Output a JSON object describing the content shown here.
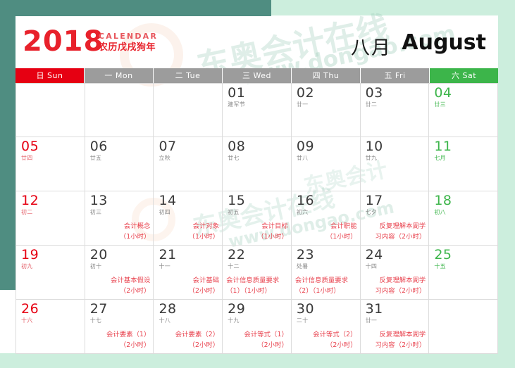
{
  "header": {
    "year": "2018",
    "subtitle_en": "CALENDAR",
    "subtitle_cn": "农历戊戌狗年",
    "month_cn": "八月",
    "month_en": "August"
  },
  "watermark": {
    "brand_cn": "东奥会计在线",
    "brand_cn_short": "东奥会计",
    "url": "www.dongao.com"
  },
  "colors": {
    "sunday": "#e60012",
    "saturday": "#3cb54a",
    "weekday_header": "#9c9c9c",
    "event_text": "#e8404c",
    "year_red": "#e8212b",
    "frame_teal": "#4f8d81",
    "frame_mint": "#cceedd"
  },
  "weekdays": [
    {
      "label": "日 Sun",
      "kind": "sun"
    },
    {
      "label": "一 Mon",
      "kind": "weekday"
    },
    {
      "label": "二 Tue",
      "kind": "weekday"
    },
    {
      "label": "三 Wed",
      "kind": "weekday"
    },
    {
      "label": "四 Thu",
      "kind": "weekday"
    },
    {
      "label": "五 Fri",
      "kind": "weekday"
    },
    {
      "label": "六 Sat",
      "kind": "sat"
    }
  ],
  "weeks": [
    [
      {
        "empty": true
      },
      {
        "empty": true
      },
      {
        "empty": true
      },
      {
        "day": "01",
        "lunar": "建军节",
        "event": ""
      },
      {
        "day": "02",
        "lunar": "廿一",
        "event": ""
      },
      {
        "day": "03",
        "lunar": "廿二",
        "event": ""
      },
      {
        "day": "04",
        "lunar": "廿三",
        "event": ""
      }
    ],
    [
      {
        "day": "05",
        "lunar": "廿四",
        "event": ""
      },
      {
        "day": "06",
        "lunar": "廿五",
        "event": ""
      },
      {
        "day": "07",
        "lunar": "立秋",
        "event": ""
      },
      {
        "day": "08",
        "lunar": "廿七",
        "event": ""
      },
      {
        "day": "09",
        "lunar": "廿八",
        "event": ""
      },
      {
        "day": "10",
        "lunar": "廿九",
        "event": ""
      },
      {
        "day": "11",
        "lunar": "七月",
        "event": ""
      }
    ],
    [
      {
        "day": "12",
        "lunar": "初二",
        "event": ""
      },
      {
        "day": "13",
        "lunar": "初三",
        "event": "会计概念\n（1小时）"
      },
      {
        "day": "14",
        "lunar": "初四",
        "event": "会计对象\n（1小时）"
      },
      {
        "day": "15",
        "lunar": "初五",
        "event": "会计目标\n（1小时）"
      },
      {
        "day": "16",
        "lunar": "初六",
        "event": "会计职能\n（1小时）"
      },
      {
        "day": "17",
        "lunar": "七夕",
        "event": "反复理解本周学\n习内容（2小时）"
      },
      {
        "day": "18",
        "lunar": "初八",
        "event": ""
      }
    ],
    [
      {
        "day": "19",
        "lunar": "初九",
        "event": ""
      },
      {
        "day": "20",
        "lunar": "初十",
        "event": "会计基本假设\n（2小时）"
      },
      {
        "day": "21",
        "lunar": "十一",
        "event": "会计基础\n（2小时）"
      },
      {
        "day": "22",
        "lunar": "十二",
        "event": "会计信息质量要求\n（1）（1小时）"
      },
      {
        "day": "23",
        "lunar": "处暑",
        "event": "会计信息质量要求\n（2）（1小时）"
      },
      {
        "day": "24",
        "lunar": "十四",
        "event": "反复理解本周学\n习内容（2小时）"
      },
      {
        "day": "25",
        "lunar": "十五",
        "event": ""
      }
    ],
    [
      {
        "day": "26",
        "lunar": "十六",
        "event": ""
      },
      {
        "day": "27",
        "lunar": "十七",
        "event": "会计要素（1）\n（2小时）"
      },
      {
        "day": "28",
        "lunar": "十八",
        "event": "会计要素（2）\n（2小时）"
      },
      {
        "day": "29",
        "lunar": "十九",
        "event": "会计等式（1）\n（2小时）"
      },
      {
        "day": "30",
        "lunar": "二十",
        "event": "会计等式（2）\n（2小时）"
      },
      {
        "day": "31",
        "lunar": "廿一",
        "event": "反复理解本周学\n习内容（2小时）"
      },
      {
        "empty": true
      }
    ]
  ]
}
